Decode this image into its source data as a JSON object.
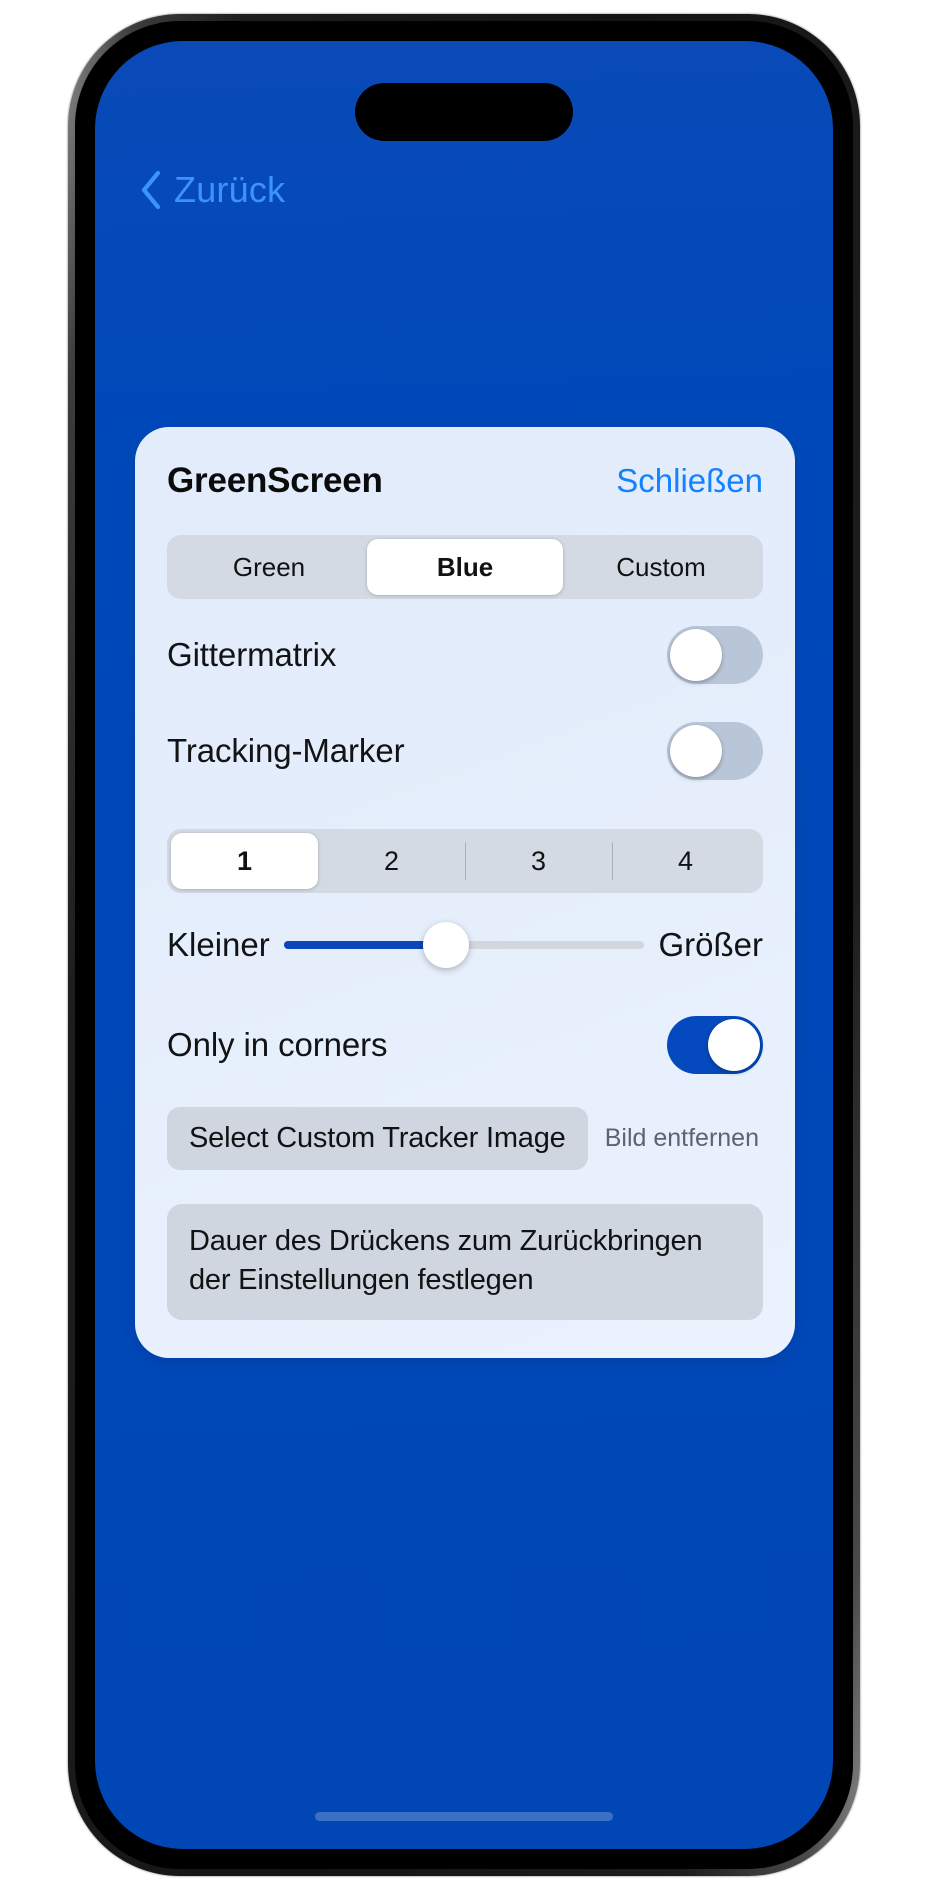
{
  "theme": {
    "screen_background": "#0048b9",
    "card_background": "#e6eefc",
    "accent_blue": "#1481ff",
    "back_link_blue": "#3b93ff",
    "toggle_on_blue": "#0449bd",
    "slider_fill_blue": "#0b45ba",
    "control_track_gray": "#d4dae3",
    "button_gray": "#cfd6e0"
  },
  "nav": {
    "back_label": "Zurück",
    "back_icon": "chevron-left-icon"
  },
  "card": {
    "title": "GreenScreen",
    "close_label": "Schließen",
    "color_mode": {
      "options": [
        "Green",
        "Blue",
        "Custom"
      ],
      "selected": "Blue",
      "selected_index": 1
    },
    "rows": [
      {
        "label": "Gittermatrix",
        "toggle": "off"
      },
      {
        "label": "Tracking-Marker",
        "toggle": "off"
      }
    ],
    "marker_count": {
      "options": [
        "1",
        "2",
        "3",
        "4"
      ],
      "selected": "1",
      "selected_index": 0
    },
    "size_slider": {
      "min_label": "Kleiner",
      "max_label": "Größer",
      "value_percent": 45
    },
    "corners_row": {
      "label": "Only in corners",
      "toggle": "on"
    },
    "tracker_image": {
      "select_label": "Select Custom Tracker Image",
      "remove_label": "Bild entfernen"
    },
    "press_duration_info": "Dauer des Drückens zum Zurückbringen der Einstellungen festlegen"
  }
}
